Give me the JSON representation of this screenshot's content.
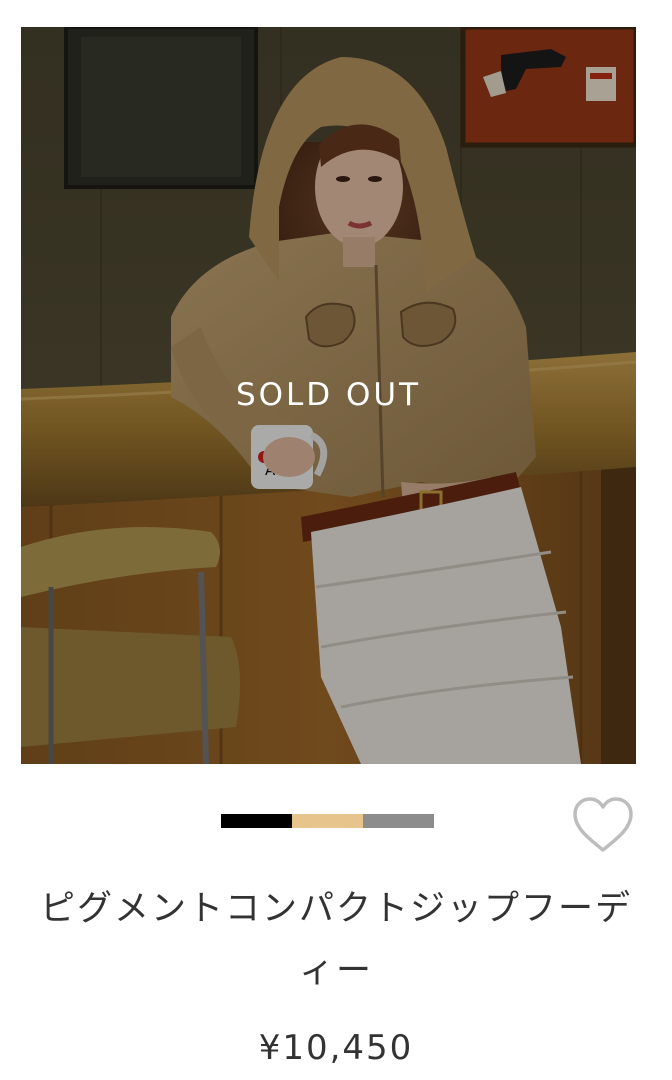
{
  "product": {
    "image_status": "SOLD OUT",
    "name": "ピグメントコンパクトジップフーディー",
    "price": "¥10,450",
    "favorite_icon": "heart-outline-icon"
  },
  "color_swatches": [
    {
      "name": "black",
      "color": "#000000"
    },
    {
      "name": "beige",
      "color": "#E8C48D"
    },
    {
      "name": "gray",
      "color": "#8C8C8C"
    }
  ],
  "colors": {
    "text": "#333333",
    "overlay_text": "#FFFFFF",
    "heart_outline": "#BDBDBD"
  }
}
